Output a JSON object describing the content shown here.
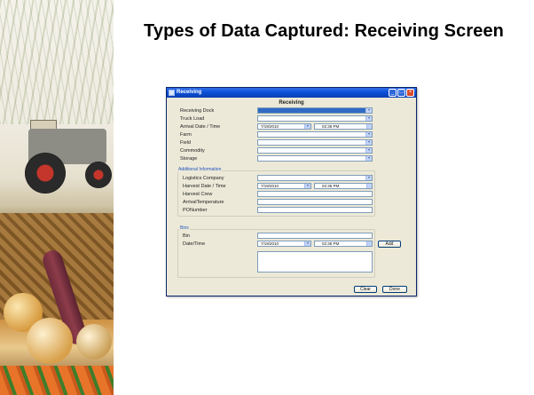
{
  "slide": {
    "title": "Types of Data Captured: Receiving Screen"
  },
  "window": {
    "title": "Receiving",
    "controls": {
      "minimize_icon": "minimize-icon",
      "maximize_icon": "maximize-icon",
      "close_icon": "close-icon"
    }
  },
  "form": {
    "heading": "Receiving",
    "receiving_dock": {
      "label": "Receiving Dock",
      "value": ""
    },
    "truck_load": {
      "label": "Truck Load",
      "value": ""
    },
    "arrival": {
      "label": "Arrival Date / Time",
      "date": "7/19/2010",
      "time": "02:36 PM"
    },
    "farm": {
      "label": "Farm",
      "value": ""
    },
    "field": {
      "label": "Field",
      "value": ""
    },
    "commodity": {
      "label": "Commodity",
      "value": ""
    },
    "storage": {
      "label": "Storage",
      "value": ""
    }
  },
  "additional": {
    "title": "Additional Information",
    "logistics_company": {
      "label": "Logistics Company",
      "value": ""
    },
    "harvest": {
      "label": "Harvest Date / Time",
      "date": "7/19/2010",
      "time": "02:36 PM"
    },
    "harvest_crew": {
      "label": "Harvest Crew",
      "value": ""
    },
    "arrival_temperature": {
      "label": "ArrivalTemperature",
      "value": ""
    },
    "po_number": {
      "label": "PONumber",
      "value": ""
    }
  },
  "bins": {
    "title": "Bins",
    "bin": {
      "label": "Bin",
      "value": ""
    },
    "datetime": {
      "label": "Date/Time",
      "date": "7/19/2010",
      "time": "02:36 PM"
    },
    "add_label": "Add"
  },
  "footer": {
    "clear_label": "Clear",
    "done_label": "Done"
  },
  "colors": {
    "titlebar": "#0a4fd6",
    "window_bg": "#ece9d8",
    "section_title": "#2255bb",
    "close_button": "#d8492a"
  }
}
